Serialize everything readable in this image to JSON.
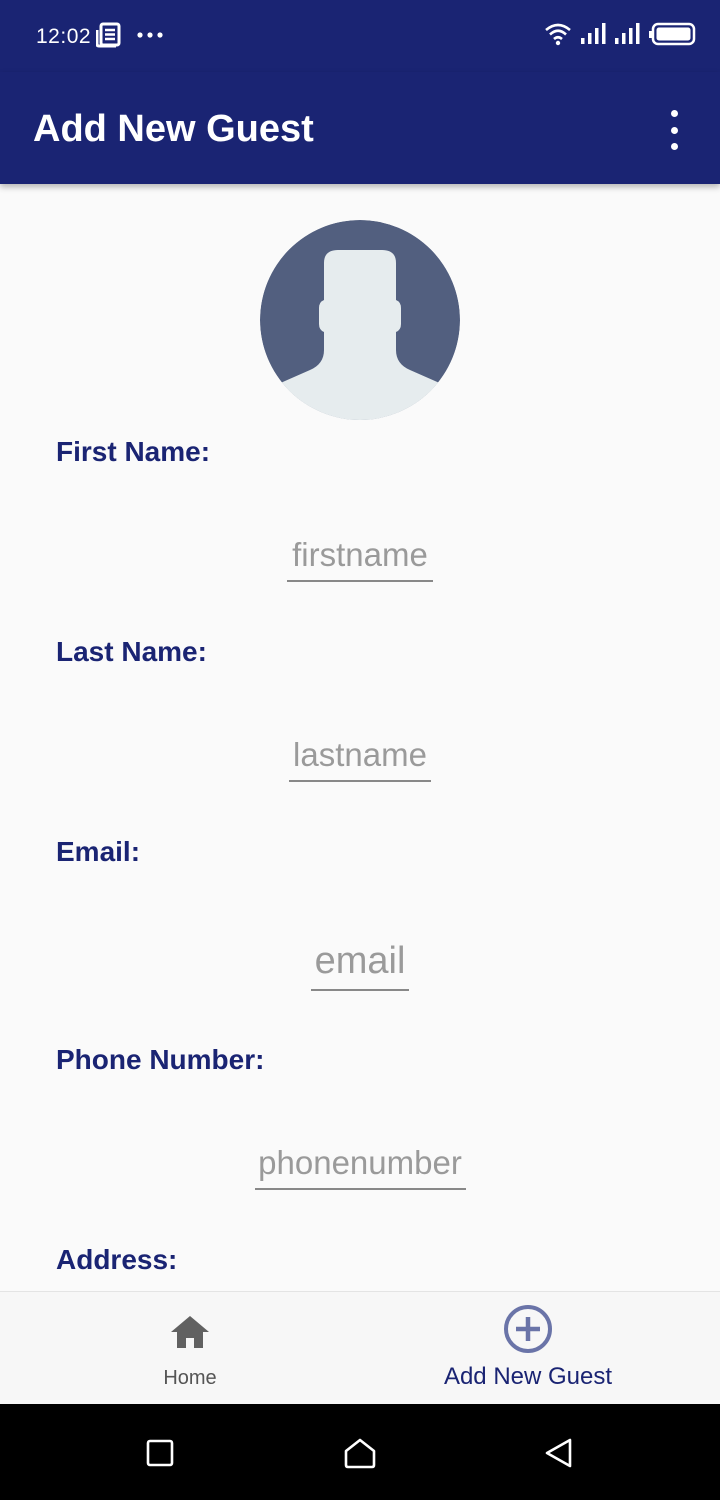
{
  "status_bar": {
    "time": "12:02",
    "icons": [
      "news-icon",
      "more-dots-icon",
      "wifi-icon",
      "signal-icon",
      "signal-icon",
      "battery-icon"
    ]
  },
  "app_bar": {
    "title": "Add New Guest",
    "menu_icon": "more-vert-icon",
    "background": "#1a2473"
  },
  "avatar": {
    "icon": "person-silhouette-icon",
    "color": "#525f7f"
  },
  "form": {
    "first_name": {
      "label": "First Name:",
      "placeholder": "firstname",
      "value": ""
    },
    "last_name": {
      "label": "Last Name:",
      "placeholder": "lastname",
      "value": ""
    },
    "email": {
      "label": "Email:",
      "placeholder": "email",
      "value": ""
    },
    "phone": {
      "label": "Phone Number:",
      "placeholder": "phonenumber",
      "value": ""
    },
    "address": {
      "label": "Address:"
    }
  },
  "bottom_nav": {
    "items": [
      {
        "label": "Home",
        "icon": "home-icon",
        "selected": false
      },
      {
        "label": "Add New Guest",
        "icon": "add-circle-icon",
        "selected": true
      }
    ]
  },
  "system_nav": {
    "icons": [
      "recents-icon",
      "home-outline-icon",
      "back-icon"
    ]
  }
}
